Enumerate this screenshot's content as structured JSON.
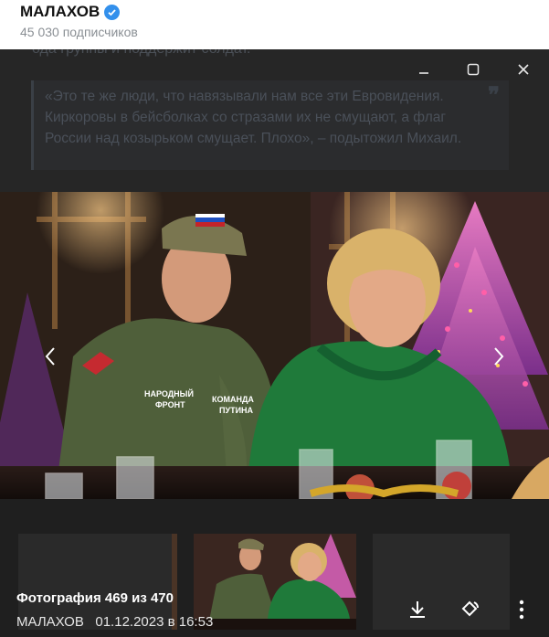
{
  "channel": {
    "name": "МАЛАХОВ",
    "subscribers": "45 030 подписчиков"
  },
  "post": {
    "cut_line": "ода группы и поддержит солдат.",
    "quote": "«Это те же люди, что навязывали нам все эти Евровидения. Киркоровы в бейсболках со стразами их не смущают, а флаг России над козырьком смущает. Плохо», – подытожил Михаил.",
    "quote_mark": "❞"
  },
  "viewer": {
    "counter": "Фотография 469 из 470",
    "author": "МАЛАХОВ",
    "date": "01.12.2023 в 16:53"
  },
  "colors": {
    "verified": "#3390ec",
    "shirt_green": "#4f5f3a",
    "dress_green": "#1f7a3a",
    "tree_pink": "#d44da0"
  }
}
